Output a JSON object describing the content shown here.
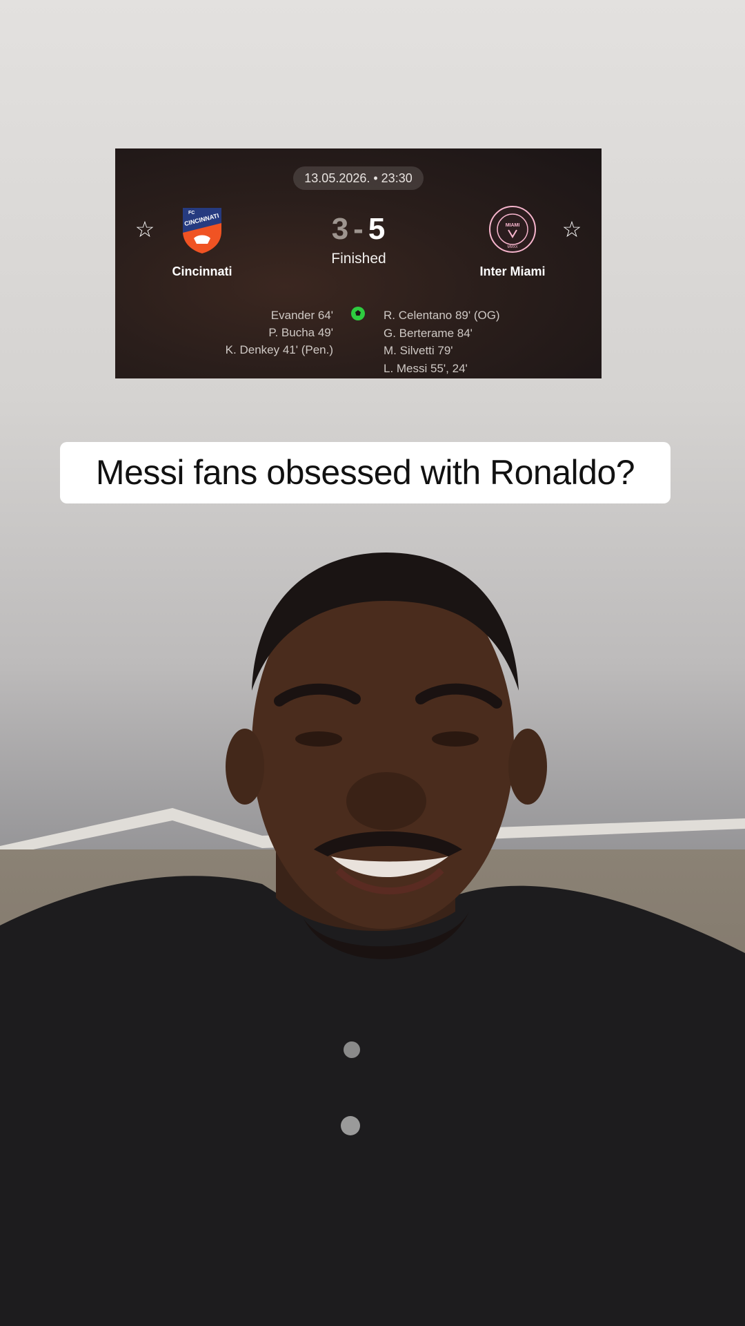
{
  "match": {
    "datetime": "13.05.2026. • 23:30",
    "home_team": "Cincinnati",
    "away_team": "Inter Miami",
    "home_score": "3",
    "away_score": "5",
    "separator": "-",
    "status": "Finished",
    "home_scorers": [
      "Evander 64'",
      "P. Bucha 49'",
      "K. Denkey 41' (Pen.)"
    ],
    "away_scorers": [
      "R. Celentano 89' (OG)",
      "G. Berterame 84'",
      "M. Silvetti 79'",
      "L. Messi 55', 24'"
    ],
    "home_crest_text": "FC CINCINNATI",
    "away_crest_text": "CLUB INTERNACIONAL DE FÚTBOL MIAMI MMXX"
  },
  "caption": {
    "text": "Messi fans obsessed with Ronaldo?"
  },
  "colors": {
    "card_bg": "#2a1e1b",
    "goal_icon": "#2ecc40",
    "caption_bg": "#ffffff"
  },
  "icons": [
    "star-icon",
    "soccer-ball-icon",
    "cincinnati-crest-icon",
    "inter-miami-crest-icon"
  ]
}
